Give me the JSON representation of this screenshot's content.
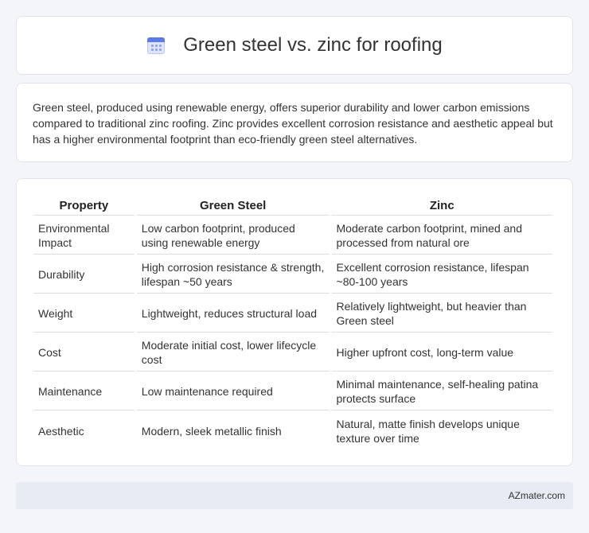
{
  "header": {
    "title": "Green steel vs. zinc for roofing",
    "icon": "calendar-icon"
  },
  "description": "Green steel, produced using renewable energy, offers superior durability and lower carbon emissions compared to traditional zinc roofing. Zinc provides excellent corrosion resistance and aesthetic appeal but has a higher environmental footprint than eco-friendly green steel alternatives.",
  "table": {
    "headers": [
      "Property",
      "Green Steel",
      "Zinc"
    ],
    "rows": [
      [
        "Environmental Impact",
        "Low carbon footprint, produced using renewable energy",
        "Moderate carbon footprint, mined and processed from natural ore"
      ],
      [
        "Durability",
        "High corrosion resistance & strength, lifespan ~50 years",
        "Excellent corrosion resistance, lifespan ~80-100 years"
      ],
      [
        "Weight",
        "Lightweight, reduces structural load",
        "Relatively lightweight, but heavier than Green steel"
      ],
      [
        "Cost",
        "Moderate initial cost, lower lifecycle cost",
        "Higher upfront cost, long-term value"
      ],
      [
        "Maintenance",
        "Low maintenance required",
        "Minimal maintenance, self-healing patina protects surface"
      ],
      [
        "Aesthetic",
        "Modern, sleek metallic finish",
        "Natural, matte finish develops unique texture over time"
      ]
    ]
  },
  "footer": {
    "site": "AZmater.com"
  }
}
